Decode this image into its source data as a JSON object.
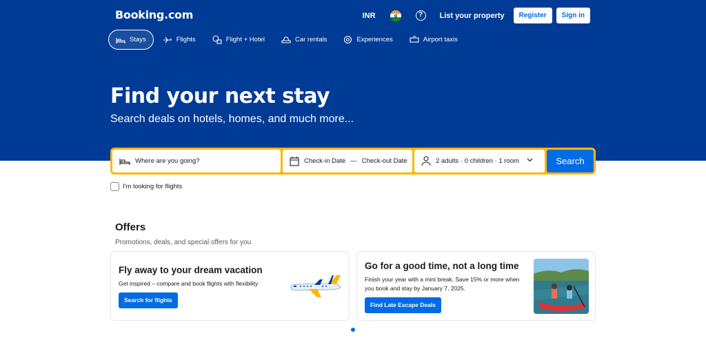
{
  "header": {
    "logo": "Booking.com",
    "currency": "INR",
    "help": "?",
    "list_property": "List your property",
    "register": "Register",
    "sign_in": "Sign in"
  },
  "nav": {
    "stays": "Stays",
    "flights": "Flights",
    "flight_hotel": "Flight + Hotel",
    "car_rentals": "Car rentals",
    "experiences": "Experiences",
    "airport_taxis": "Airport taxis"
  },
  "hero": {
    "title": "Find your next stay",
    "subtitle": "Search deals on hotels, homes, and much more..."
  },
  "search": {
    "destination_placeholder": "Where are you going?",
    "checkin": "Check-in Date",
    "dash": "—",
    "checkout": "Check-out Date",
    "occupancy": "2 adults · 0 children · 1 room",
    "button": "Search",
    "flights_checkbox": "I'm looking for flights"
  },
  "offers": {
    "title": "Offers",
    "subtitle": "Promotions, deals, and special offers for you",
    "cards": [
      {
        "title": "Fly away to your dream vacation",
        "description": "Get inspired – compare and book flights with flexibility",
        "button": "Search for flights"
      },
      {
        "title": "Go for a good time, not a long time",
        "description": "Finish your year with a mini break. Save 15% or more when you book and stay by January 7, 2025.",
        "button": "Find Late Escape Deals"
      }
    ]
  },
  "colors": {
    "brand_blue": "#003b95",
    "action_blue": "#006ce4",
    "search_border": "#ffb700"
  },
  "icons": [
    "bed-icon",
    "plane-icon",
    "flight-hotel-icon",
    "car-icon",
    "experiences-icon",
    "taxi-icon",
    "calendar-icon",
    "person-icon",
    "chevron-down-icon",
    "help-icon"
  ]
}
